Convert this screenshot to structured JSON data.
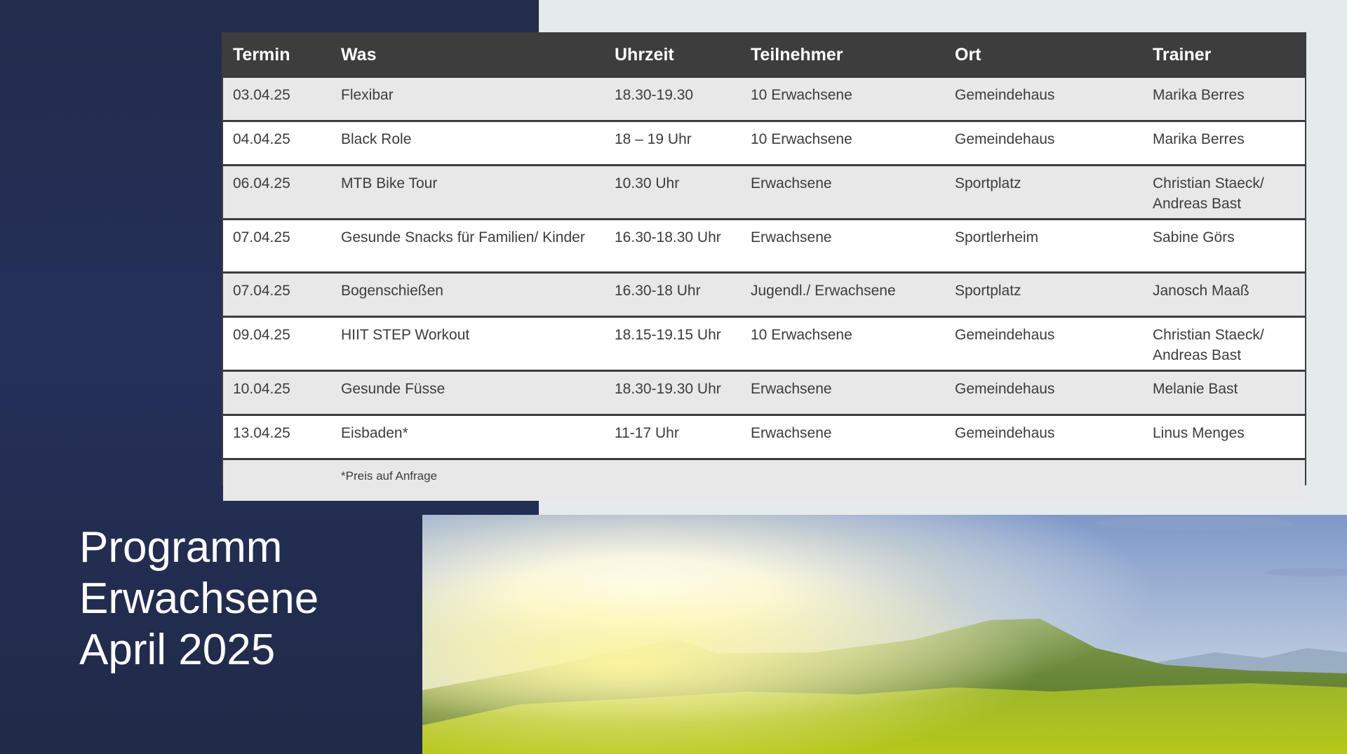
{
  "slide": {
    "title_lines": [
      "Programm",
      "Erwachsene",
      "April 2025"
    ]
  },
  "table": {
    "headers": [
      "Termin",
      "Was",
      "Uhrzeit",
      "Teilnehmer",
      "Ort",
      "Trainer"
    ],
    "rows": [
      {
        "termin": "03.04.25",
        "was": "Flexibar",
        "uhrzeit": "18.30-19.30",
        "teilnehmer": "10 Erwachsene",
        "ort": "Gemeindehaus",
        "trainer": "Marika Berres"
      },
      {
        "termin": "04.04.25",
        "was": "Black Role",
        "uhrzeit": "18 – 19 Uhr",
        "teilnehmer": "10 Erwachsene",
        "ort": "Gemeindehaus",
        "trainer": "Marika Berres"
      },
      {
        "termin": "06.04.25",
        "was": "MTB Bike Tour",
        "uhrzeit": "10.30 Uhr",
        "teilnehmer": "Erwachsene",
        "ort": "Sportplatz",
        "trainer": "Christian Staeck/ Andreas Bast"
      },
      {
        "termin": "07.04.25",
        "was": "Gesunde Snacks für Familien/ Kinder",
        "uhrzeit": "16.30-18.30 Uhr",
        "teilnehmer": "Erwachsene",
        "ort": "Sportlerheim",
        "trainer": "Sabine Görs"
      },
      {
        "termin": "07.04.25",
        "was": "Bogenschießen",
        "uhrzeit": "16.30-18 Uhr",
        "teilnehmer": "Jugendl./ Erwachsene",
        "ort": "Sportplatz",
        "trainer": "Janosch Maaß"
      },
      {
        "termin": "09.04.25",
        "was": "HIIT STEP Workout",
        "uhrzeit": "18.15-19.15 Uhr",
        "teilnehmer": "10 Erwachsene",
        "ort": "Gemeindehaus",
        "trainer": "Christian Staeck/ Andreas Bast"
      },
      {
        "termin": "10.04.25",
        "was": "Gesunde Füsse",
        "uhrzeit": "18.30-19.30 Uhr",
        "teilnehmer": "Erwachsene",
        "ort": "Gemeindehaus",
        "trainer": "Melanie Bast"
      },
      {
        "termin": "13.04.25",
        "was": "Eisbaden*",
        "uhrzeit": "11-17 Uhr",
        "teilnehmer": "Erwachsene",
        "ort": "Gemeindehaus",
        "trainer": "Linus Menges"
      }
    ],
    "footnote": "*Preis auf Anfrage"
  }
}
